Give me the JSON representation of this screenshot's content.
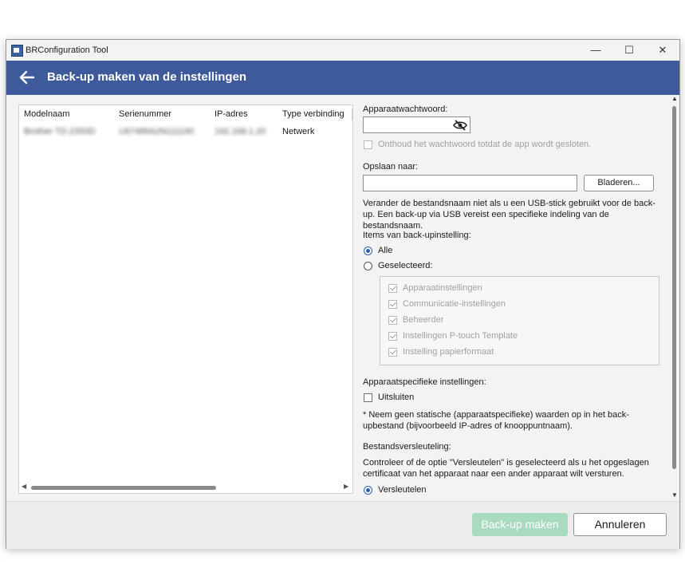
{
  "window": {
    "title": "BRConfiguration Tool",
    "minimize": "—",
    "maximize": "☐",
    "close": "✕"
  },
  "header": {
    "title": "Back-up maken van de instellingen",
    "bg_color": "#3e5a9a"
  },
  "table": {
    "columns": [
      "Modelnaam",
      "Serienummer",
      "IP-adres",
      "Type verbinding"
    ],
    "rows": [
      {
        "model": "Brother TD-2350D",
        "serial": "U67489A2N111190",
        "ip": "192.168.1.20",
        "connection": "Netwerk"
      }
    ]
  },
  "form": {
    "password_label": "Apparaatwachtwoord:",
    "password_icon": "eye-slash-icon",
    "remember_label": "Onthoud het wachtwoord totdat de app wordt gesloten.",
    "save_to_label": "Opslaan naar:",
    "browse_label": "Bladeren...",
    "usb_note": "Verander de bestandsnaam niet als u een USB-stick gebruikt voor de back-up. Een back-up via USB vereist een specifieke indeling van de bestandsnaam.",
    "items_label": "Items van back-upinstelling:",
    "all_label": "Alle",
    "selected_label": "Geselecteerd:",
    "items": [
      "Apparaatinstellingen",
      "Communicatie-instellingen",
      "Beheerder",
      "Instellingen P-touch Template",
      "Instelling papierformaat"
    ],
    "device_specific_label": "Apparaatspecifieke instellingen:",
    "exclude_label": "Uitsluiten",
    "exclude_note": "* Neem geen statische (apparaatspecifieke) waarden op in het back-upbestand (bijvoorbeeld IP-adres of knooppuntnaam).",
    "encryption_label": "Bestandsversleuteling:",
    "encryption_note": "Controleer of de optie \"Versleutelen\" is geselecteerd als u het opgeslagen certificaat van het apparaat naar een ander apparaat wilt versturen.",
    "encrypt_label": "Versleutelen"
  },
  "footer": {
    "backup_button": "Back-up maken",
    "cancel_button": "Annuleren",
    "backup_button_color": "#a9dbc0"
  }
}
